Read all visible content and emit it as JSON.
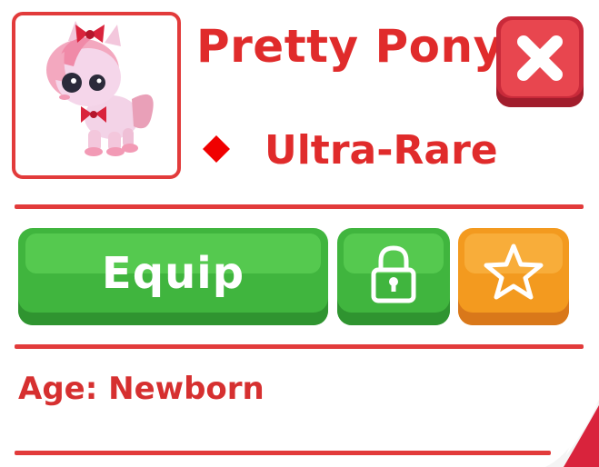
{
  "pet": {
    "name": "Pretty Pony",
    "rarity": "Ultra-Rare",
    "age_text": "Age: Newborn"
  },
  "actions": {
    "equip_label": "Equip"
  },
  "icons": {
    "close": "close-x-icon",
    "rarity": "red-diamond-icon",
    "lock": "padlock-icon",
    "favorite": "star-icon",
    "pet": "pony-portrait-icon"
  },
  "colors": {
    "accent_red": "#e02b2b",
    "equip_green": "#40b53e",
    "favorite_orange": "#f39a1f",
    "close_red": "#e8464f"
  }
}
